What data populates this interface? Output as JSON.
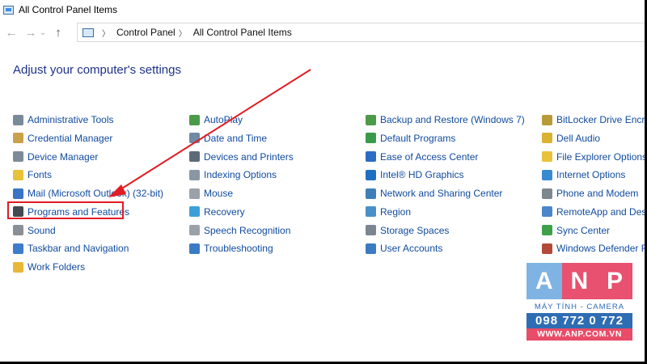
{
  "window": {
    "title": "All Control Panel Items"
  },
  "address": {
    "crumbs": [
      "Control Panel",
      "All Control Panel Items"
    ]
  },
  "heading": "Adjust your computer's settings",
  "columns": [
    [
      {
        "label": "Administrative Tools",
        "icon": "admin-tools-icon",
        "color": "#7a8a99"
      },
      {
        "label": "Credential Manager",
        "icon": "credential-manager-icon",
        "color": "#c8a24a"
      },
      {
        "label": "Device Manager",
        "icon": "device-manager-icon",
        "color": "#7d8b98"
      },
      {
        "label": "Fonts",
        "icon": "fonts-icon",
        "color": "#e8c23a"
      },
      {
        "label": "Mail (Microsoft Outlook) (32-bit)",
        "icon": "mail-icon",
        "color": "#3b74c4"
      },
      {
        "label": "Programs and Features",
        "icon": "programs-features-icon",
        "color": "#444a52"
      },
      {
        "label": "Sound",
        "icon": "sound-icon",
        "color": "#8a8f96"
      },
      {
        "label": "Taskbar and Navigation",
        "icon": "taskbar-icon",
        "color": "#3e7ccc"
      },
      {
        "label": "Work Folders",
        "icon": "work-folders-icon",
        "color": "#e8b83a"
      }
    ],
    [
      {
        "label": "AutoPlay",
        "icon": "autoplay-icon",
        "color": "#4a9a4a"
      },
      {
        "label": "Date and Time",
        "icon": "date-time-icon",
        "color": "#6f8aa5"
      },
      {
        "label": "Devices and Printers",
        "icon": "devices-printers-icon",
        "color": "#5d6a78"
      },
      {
        "label": "Indexing Options",
        "icon": "indexing-icon",
        "color": "#8a96a3"
      },
      {
        "label": "Mouse",
        "icon": "mouse-icon",
        "color": "#9aa1a8"
      },
      {
        "label": "Recovery",
        "icon": "recovery-icon",
        "color": "#3ba0d8"
      },
      {
        "label": "Speech Recognition",
        "icon": "speech-icon",
        "color": "#9aa1a8"
      },
      {
        "label": "Troubleshooting",
        "icon": "troubleshooting-icon",
        "color": "#3b7bc4"
      }
    ],
    [
      {
        "label": "Backup and Restore (Windows 7)",
        "icon": "backup-icon",
        "color": "#4d9a4a"
      },
      {
        "label": "Default Programs",
        "icon": "default-programs-icon",
        "color": "#3a9a4a"
      },
      {
        "label": "Ease of Access Center",
        "icon": "ease-access-icon",
        "color": "#2b6cc4"
      },
      {
        "label": "Intel® HD Graphics",
        "icon": "intel-icon",
        "color": "#1f6fc0"
      },
      {
        "label": "Network and Sharing Center",
        "icon": "network-icon",
        "color": "#3f7fb8"
      },
      {
        "label": "Region",
        "icon": "region-icon",
        "color": "#4a90c8"
      },
      {
        "label": "Storage Spaces",
        "icon": "storage-icon",
        "color": "#7a8590"
      },
      {
        "label": "User Accounts",
        "icon": "user-accounts-icon",
        "color": "#3c7bc0"
      }
    ],
    [
      {
        "label": "BitLocker Drive Encryption",
        "icon": "bitlocker-icon",
        "color": "#b89a3a"
      },
      {
        "label": "Dell Audio",
        "icon": "dell-audio-icon",
        "color": "#d9b232"
      },
      {
        "label": "File Explorer Options",
        "icon": "file-explorer-icon",
        "color": "#e8c23a"
      },
      {
        "label": "Internet Options",
        "icon": "internet-options-icon",
        "color": "#3a8ad0"
      },
      {
        "label": "Phone and Modem",
        "icon": "phone-modem-icon",
        "color": "#7d8790"
      },
      {
        "label": "RemoteApp and Desktop Connections",
        "icon": "remoteapp-icon",
        "color": "#4a86c8"
      },
      {
        "label": "Sync Center",
        "icon": "sync-center-icon",
        "color": "#3fa04a"
      },
      {
        "label": "Windows Defender Firewall",
        "icon": "firewall-icon",
        "color": "#b24a3a"
      }
    ]
  ],
  "logo": {
    "letters": [
      "A",
      "N",
      "P"
    ],
    "letter_colors": [
      "#7fb3e3",
      "#e8516f",
      "#e8516f"
    ],
    "tagline": "MÁY TÍNH - CAMERA",
    "phone": "098 772 0 772",
    "website": "WWW.ANP.COM.VN"
  },
  "colors": {
    "highlight": "#e31b23",
    "arrow": "#e31b23",
    "heading": "#1e3287",
    "link": "#104a9e"
  }
}
